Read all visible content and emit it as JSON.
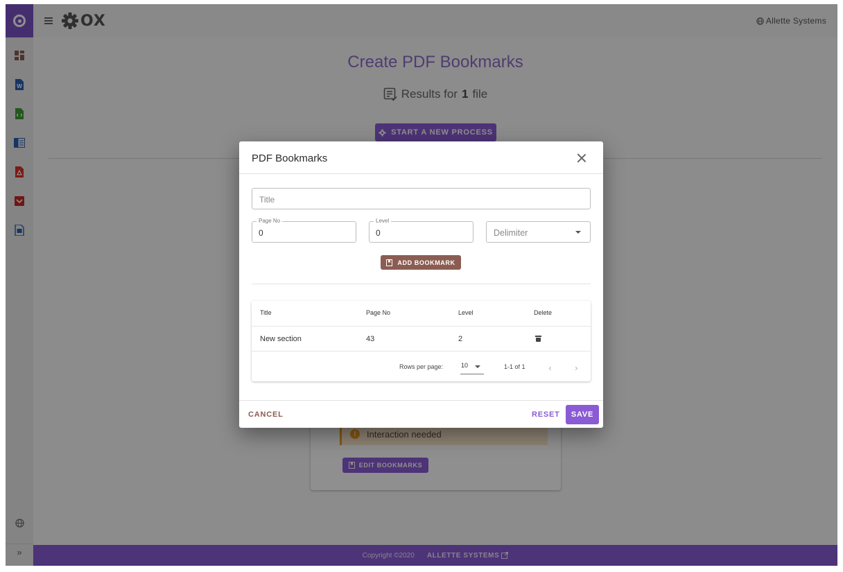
{
  "app": {
    "brand": "OX",
    "company": "Allette Systems"
  },
  "page": {
    "title": "Create PDF Bookmarks",
    "results_prefix": "Results for",
    "results_count": "1",
    "results_suffix": "file",
    "start_button": "START A NEW PROCESS",
    "interaction_text": "Interaction needed",
    "edit_button": "EDIT BOOKMARKS"
  },
  "footer": {
    "copyright": "Copyright ©2020",
    "org": "ALLETTE SYSTEMS"
  },
  "dialog": {
    "title": "PDF Bookmarks",
    "title_placeholder": "Title",
    "page_no_label": "Page No",
    "page_no_value": "0",
    "level_label": "Level",
    "level_value": "0",
    "delimiter_placeholder": "Delimiter",
    "add_button": "ADD BOOKMARK",
    "table": {
      "headers": [
        "Title",
        "Page No",
        "Level",
        "Delete"
      ],
      "rows": [
        {
          "title": "New section",
          "page_no": "43",
          "level": "2"
        }
      ],
      "rows_per_page_label": "Rows per page:",
      "rows_per_page": "10",
      "range": "1-1 of 1"
    },
    "cancel": "CANCEL",
    "reset": "RESET",
    "save": "SAVE"
  },
  "colors": {
    "primary": "#8a5bd4",
    "secondary": "#8b5d52",
    "warning": "#f29c1f"
  }
}
